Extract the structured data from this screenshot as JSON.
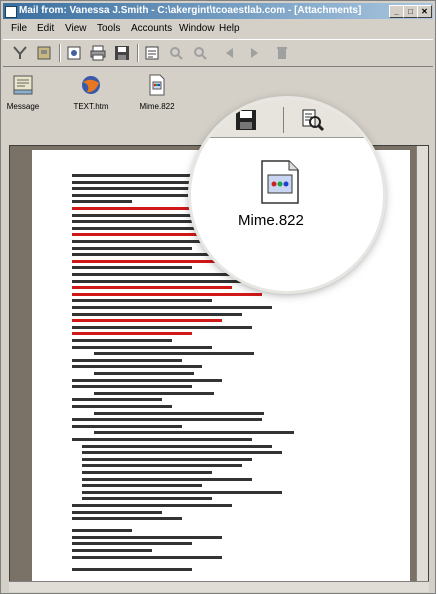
{
  "window": {
    "title": "Mail from: Vanessa J.Smith - C:\\akergint\\tcoaestlab.com - [Attachments]"
  },
  "menubar": {
    "items": [
      "File",
      "Edit",
      "View",
      "Tools",
      "Accounts",
      "Window",
      "Help"
    ]
  },
  "attachments": [
    {
      "label": "Message",
      "icon": "message-icon"
    },
    {
      "label": "TEXT.htm",
      "icon": "browser-icon"
    },
    {
      "label": "Mime.822",
      "icon": "mime-file-icon"
    }
  ],
  "callout": {
    "label": "Mime.822"
  },
  "colors": {
    "titlebar_start": "#3a6fa0",
    "titlebar_end": "#a9c6df",
    "window_bg": "#d4d0c8",
    "content_bg": "#7a7266",
    "link_red": "#d01818"
  }
}
